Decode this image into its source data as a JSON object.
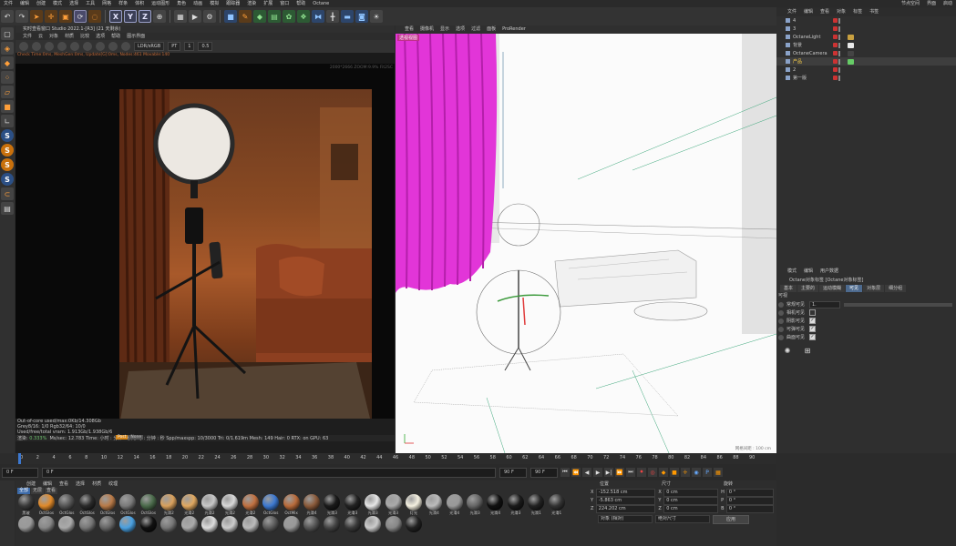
{
  "menubar": {
    "items": [
      "文件",
      "编辑",
      "创建",
      "模式",
      "选择",
      "工具",
      "网格",
      "样条",
      "体积",
      "运动图形",
      "角色",
      "动画",
      "模拟",
      "跟踪器",
      "渲染",
      "扩展",
      "窗口",
      "帮助",
      "Octane"
    ],
    "right": [
      "节点空间",
      "",
      "界面",
      "启动"
    ]
  },
  "toolbar": {
    "xyz": [
      "X",
      "Y",
      "Z"
    ]
  },
  "live_viewer": {
    "title": "实时查看窗口 Studio 2022.1-[R3] (21 天剩余)",
    "menu": [
      "文件",
      "云",
      "对象",
      "材质",
      "比较",
      "选项",
      "帮助",
      "图示界面"
    ],
    "tools": {
      "colorspace": "LDR/sRGB",
      "mode": "PT",
      "value1": "1",
      "value2": "0.5"
    },
    "status_line": "Check Time:0ms, MeshGen:0ms, Update[G]:0ms, Nodes:461 Movable:140",
    "overlay_right": "2000*2666 ZOOM:9.9% Fit2SC",
    "stats": [
      "Out-of-core used/max:0Kb/14.308Gb",
      "Grey8/16: 1/0          Rgb32/64: 10/0",
      "Used/free/total vram: 1.913Gb/1.938Gb/6"
    ],
    "bottom_bar": {
      "render_label": "渲染:",
      "percent": "0.333%",
      "mssec_label": "Ms/sec:",
      "mssec": "12.783",
      "time_label": "Time:",
      "time": "小时 : 分钟 : 秒/小时 : 分钟 : 秒",
      "spp_label": "Spp/maxspp:",
      "spp": "10/3000",
      "tri_label": "Tri:",
      "tri": "0/1.619m",
      "mesh_label": "Mesh:",
      "mesh": "149",
      "hair_label": "Hair:",
      "hair": "0",
      "rtx_label": "RTX:",
      "rtx": "on",
      "gpu_label": "GPU:",
      "gpu": "63"
    },
    "tags": [
      "Post",
      "None"
    ]
  },
  "viewport": {
    "menu": [
      "查看",
      "摄像机",
      "显示",
      "选项",
      "过滤",
      "面板",
      "ProRender"
    ],
    "camera_label": "透视视图",
    "grid_label": "网格间距 : 100 cm"
  },
  "object_manager": {
    "menu": [
      "文件",
      "编辑",
      "查看",
      "对象",
      "标签",
      "书签"
    ],
    "rows": [
      {
        "name": "4",
        "chk": "#cc3333",
        "tag": ""
      },
      {
        "name": "3",
        "chk": "#cc3333",
        "tag": ""
      },
      {
        "name": "OctaneLight",
        "chk": "#cc3333",
        "tag": "#c8a040"
      },
      {
        "name": "背景",
        "chk": "#cc3333",
        "tag": "#e8e8e8"
      },
      {
        "name": "OctaneCamera",
        "chk": "#cc3333",
        "tag": "#444"
      },
      {
        "name": "产品",
        "chk": "#cc3333",
        "tag": "#6c6",
        "sel": true
      },
      {
        "name": "2",
        "chk": "#cc3333",
        "tag": ""
      },
      {
        "name": "第一版",
        "chk": "#cc3333",
        "tag": ""
      }
    ]
  },
  "attributes": {
    "menu": [
      "模式",
      "编辑",
      "用户数据"
    ],
    "title": "Octane对象标签 [Octane对象标签]",
    "tabs": [
      {
        "label": "基本",
        "on": false
      },
      {
        "label": "主要的",
        "on": false
      },
      {
        "label": "运动模糊",
        "on": false
      },
      {
        "label": "可见",
        "on": true
      },
      {
        "label": "对象层",
        "on": false
      },
      {
        "label": "细分组",
        "on": false
      }
    ],
    "section": "可视",
    "rows": [
      {
        "label": "常规可见",
        "value": "1."
      },
      {
        "label": "相机可见",
        "checked": false
      },
      {
        "label": "阴影可见",
        "checked": true
      },
      {
        "label": "可弹可见",
        "checked": true
      },
      {
        "label": "曲面可见",
        "checked": true
      }
    ]
  },
  "timeline": {
    "ticks": [
      "0",
      "2",
      "4",
      "6",
      "8",
      "10",
      "12",
      "14",
      "16",
      "18",
      "20",
      "22",
      "24",
      "26",
      "28",
      "30",
      "32",
      "34",
      "36",
      "38",
      "40",
      "42",
      "44",
      "46",
      "48",
      "50",
      "52",
      "54",
      "56",
      "58",
      "60",
      "62",
      "64",
      "66",
      "68",
      "70",
      "72",
      "74",
      "76",
      "78",
      "80",
      "82",
      "84",
      "86",
      "88",
      "90"
    ],
    "current": "0 F",
    "start": "0 F",
    "end": "90 F",
    "end2": "90 F"
  },
  "materials": {
    "menu": [
      "创建",
      "编辑",
      "查看",
      "选择",
      "材质",
      "纹理"
    ],
    "filters": [
      "全部",
      "无层",
      "查看"
    ],
    "row1": [
      {
        "label": "黑玻",
        "color": "#3a3a3a"
      },
      {
        "label": "OctGlos",
        "color": "#e08a2a"
      },
      {
        "label": "OctGlos",
        "color": "#555"
      },
      {
        "label": "OctGlos",
        "color": "#2a2a2a"
      },
      {
        "label": "OctGlos",
        "color": "#b87a48"
      },
      {
        "label": "OctGlos",
        "color": "#7a7a7a"
      },
      {
        "label": "OctGlos",
        "color": "#4a6a4a"
      },
      {
        "label": "光滑2",
        "color": "#d8a05c"
      },
      {
        "label": "光滑2",
        "color": "#e0a860"
      },
      {
        "label": "光滑2",
        "color": "#c8c8c8"
      },
      {
        "label": "光滑2",
        "color": "#d8d8d8"
      },
      {
        "label": "光滑2",
        "color": "#c07040"
      },
      {
        "label": "OctGlos",
        "color": "#3c78d0"
      },
      {
        "label": "OctMix",
        "color": "#b86a3a"
      },
      {
        "label": "光滑4",
        "color": "#8a5a3a"
      },
      {
        "label": "光滑3",
        "color": "#1a1a1a"
      },
      {
        "label": "光滑3",
        "color": "#222"
      },
      {
        "label": "光滑3",
        "color": "#e6e6e6"
      },
      {
        "label": "光滑3",
        "color": "#aaa"
      },
      {
        "label": "灯光",
        "color": "#f4f0e0"
      },
      {
        "label": "光滑4",
        "color": "#bbb"
      },
      {
        "label": "光滑4",
        "color": "#999"
      },
      {
        "label": "光滑3",
        "color": "#666"
      },
      {
        "label": "光滑4",
        "color": "#111"
      },
      {
        "label": "光滑3",
        "color": "#1a1a1a"
      },
      {
        "label": "光滑1",
        "color": "#222"
      },
      {
        "label": "光滑1",
        "color": "#333"
      }
    ],
    "row2": [
      {
        "label": "",
        "color": "#999"
      },
      {
        "label": "",
        "color": "#888"
      },
      {
        "label": "",
        "color": "#aaa"
      },
      {
        "label": "",
        "color": "#777"
      },
      {
        "label": "",
        "color": "#666"
      },
      {
        "label": "",
        "color": "#4aa0e0"
      },
      {
        "label": "",
        "color": "#111"
      },
      {
        "label": "",
        "color": "#777"
      },
      {
        "label": "",
        "color": "#aaa"
      },
      {
        "label": "",
        "color": "#ddd"
      },
      {
        "label": "",
        "color": "#ccc"
      },
      {
        "label": "",
        "color": "#bbb"
      },
      {
        "label": "",
        "color": "#5a5a5a"
      },
      {
        "label": "",
        "color": "#999"
      },
      {
        "label": "",
        "color": "#555"
      },
      {
        "label": "",
        "color": "#444"
      },
      {
        "label": "",
        "color": "#3a3a3a"
      },
      {
        "label": "",
        "color": "#ccc"
      },
      {
        "label": "",
        "color": "#888"
      },
      {
        "label": "",
        "color": "#222"
      }
    ]
  },
  "coords": {
    "headers": [
      "位置",
      "尺寸",
      "旋转"
    ],
    "x": {
      "label": "X",
      "pos": "-152.518 cm",
      "size": "0 cm",
      "rot_label": "H",
      "rot": "0 °"
    },
    "y": {
      "label": "Y",
      "pos": "-5.863 cm",
      "size": "0 cm",
      "rot_label": "P",
      "rot": "0 °"
    },
    "z": {
      "label": "Z",
      "pos": "224.202 cm",
      "size": "0 cm",
      "rot_label": "B",
      "rot": "0 °"
    },
    "mode": "对象 (相对)",
    "size_mode": "绝对尺寸",
    "apply": "应用"
  }
}
